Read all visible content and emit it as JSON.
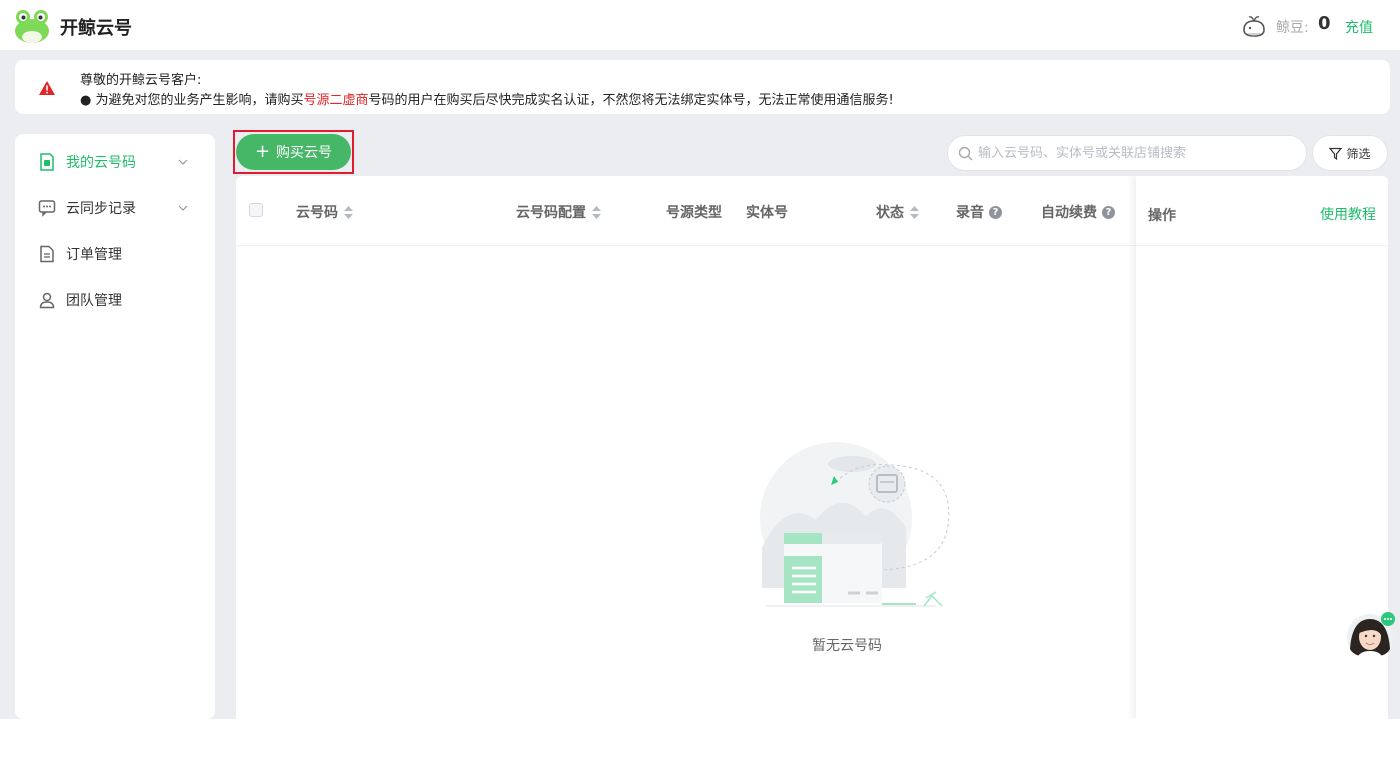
{
  "header": {
    "brand": "开鲸云号",
    "beans_label": "鲸豆:",
    "beans_value": "0",
    "recharge": "充值"
  },
  "notice": {
    "title": "尊敬的开鲸云号客户:",
    "line_prefix": "● 为避免对您的业务产生影响，请购买",
    "line_highlight": "号源二虚商",
    "line_suffix": "号码的用户在购买后尽快完成实名认证，不然您将无法绑定实体号，无法正常使用通信服务!",
    "highlight_color": "#e0262b"
  },
  "sidebar": {
    "items": [
      {
        "label": "我的云号码",
        "icon": "sim-card-icon",
        "active": true,
        "has_chevron": true
      },
      {
        "label": "云同步记录",
        "icon": "chat-record-icon",
        "active": false,
        "has_chevron": true
      },
      {
        "label": "订单管理",
        "icon": "order-document-icon",
        "active": false,
        "has_chevron": false
      },
      {
        "label": "团队管理",
        "icon": "team-user-icon",
        "active": false,
        "has_chevron": false
      }
    ]
  },
  "toolbar": {
    "buy_label": "购买云号",
    "search_placeholder": "输入云号码、实体号或关联店铺搜索",
    "filter_label": "筛选"
  },
  "table": {
    "columns": [
      {
        "label": "云号码",
        "sortable": true,
        "help": false
      },
      {
        "label": "云号码配置",
        "sortable": true,
        "help": false
      },
      {
        "label": "号源类型",
        "sortable": false,
        "help": false
      },
      {
        "label": "实体号",
        "sortable": false,
        "help": false
      },
      {
        "label": "状态",
        "sortable": true,
        "help": false
      },
      {
        "label": "录音",
        "sortable": false,
        "help": true
      },
      {
        "label": "自动续费",
        "sortable": false,
        "help": true
      }
    ],
    "operation_label": "操作",
    "tutorial_link": "使用教程",
    "empty_text": "暂无云号码"
  },
  "colors": {
    "accent": "#1ebd6b",
    "button_green": "#46b767",
    "highlight_border": "#e31b2f",
    "background": "#ebedf0"
  }
}
